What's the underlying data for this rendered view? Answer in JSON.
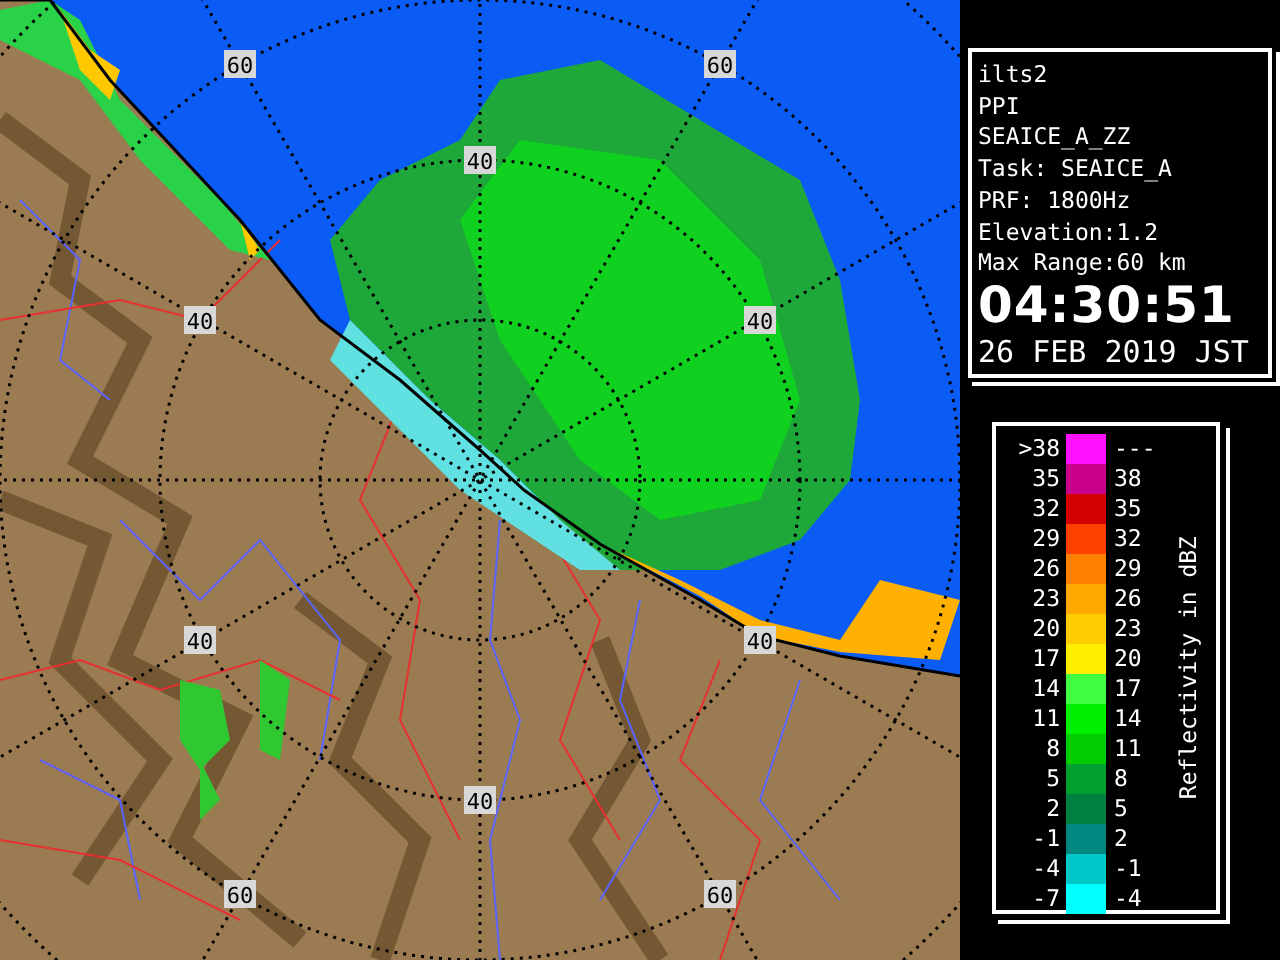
{
  "map": {
    "range_labels": [
      {
        "text": "60"
      },
      {
        "text": "60"
      },
      {
        "text": "40"
      },
      {
        "text": "40"
      },
      {
        "text": "40"
      },
      {
        "text": "40"
      },
      {
        "text": "40"
      },
      {
        "text": "40"
      },
      {
        "text": "60"
      },
      {
        "text": "60"
      }
    ]
  },
  "info": {
    "lines": [
      "ilts2",
      "PPI",
      "SEAICE_A_ZZ",
      "Task: SEAICE_A",
      "PRF: 1800Hz",
      "Elevation:1.2",
      "Max Range:60 km"
    ],
    "time": "04:30:51",
    "date": "26 FEB 2019 JST"
  },
  "legend": {
    "title": "Reflectivity in dBZ",
    "rows": [
      {
        "low": ">38",
        "high": "---",
        "color": "#ff10ff"
      },
      {
        "low": "35",
        "high": "38",
        "color": "#c8008c"
      },
      {
        "low": "32",
        "high": "35",
        "color": "#d40000"
      },
      {
        "low": "29",
        "high": "32",
        "color": "#ff4000"
      },
      {
        "low": "26",
        "high": "29",
        "color": "#ff8000"
      },
      {
        "low": "23",
        "high": "26",
        "color": "#ffa800"
      },
      {
        "low": "20",
        "high": "23",
        "color": "#ffcc00"
      },
      {
        "low": "17",
        "high": "20",
        "color": "#ffee00"
      },
      {
        "low": "14",
        "high": "17",
        "color": "#40ff40"
      },
      {
        "low": "11",
        "high": "14",
        "color": "#00ee00"
      },
      {
        "low": "8",
        "high": "11",
        "color": "#00cc00"
      },
      {
        "low": "5",
        "high": "8",
        "color": "#00a030"
      },
      {
        "low": "2",
        "high": "5",
        "color": "#008040"
      },
      {
        "low": "-1",
        "high": "2",
        "color": "#008880"
      },
      {
        "low": "-4",
        "high": "-1",
        "color": "#00c8c8"
      },
      {
        "low": "-7",
        "high": "-4",
        "color": "#00ffff"
      }
    ]
  }
}
